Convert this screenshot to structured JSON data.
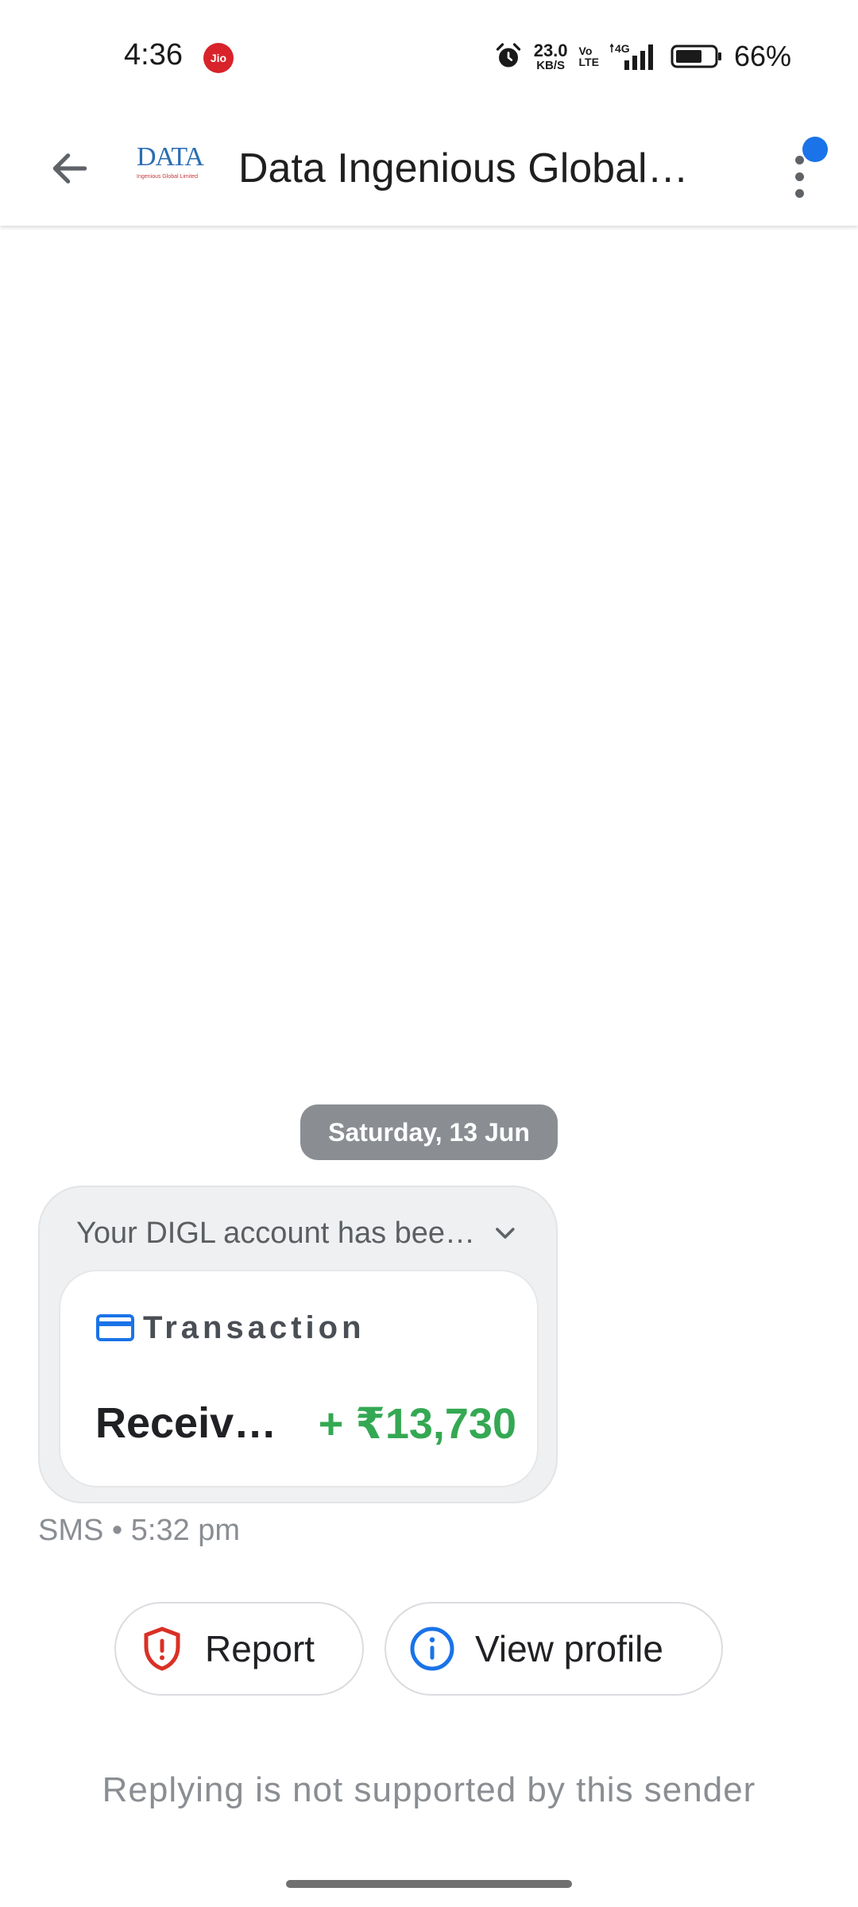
{
  "status_bar": {
    "time": "4:36",
    "carrier_badge": "Jio",
    "net_speed_value": "23.0",
    "net_speed_unit": "KB/S",
    "volte_top": "Vo",
    "volte_bottom": "LTE",
    "network": "4G",
    "battery_percent": "66%",
    "icons": [
      "alarm-icon",
      "signal-icon",
      "battery-icon"
    ]
  },
  "header": {
    "back_icon": "arrow-left-icon",
    "logo_brand": "DATA",
    "logo_tagline": "Ingenious Global Limited",
    "title": "Data Ingenious Global…",
    "more_icon": "more-vert-icon",
    "has_notification_dot": true
  },
  "conversation": {
    "date_chip": "Saturday, 13 Jun",
    "message": {
      "preview": "Your DIGL account has bee…",
      "expand_icon": "chevron-down-icon",
      "card": {
        "icon": "credit-card-icon",
        "label": "Transaction",
        "description": "Receiv…",
        "amount": "+ ₹13,730"
      },
      "meta": "SMS • 5:32 pm"
    }
  },
  "actions": {
    "report_label": "Report",
    "report_icon": "shield-alert-icon",
    "profile_label": "View profile",
    "profile_icon": "info-icon"
  },
  "footer_note": "Replying is not supported by this sender",
  "colors": {
    "accent_blue": "#1a73e8",
    "amount_green": "#34a853",
    "report_red": "#d93025",
    "chip_grey": "#8a8e93"
  }
}
